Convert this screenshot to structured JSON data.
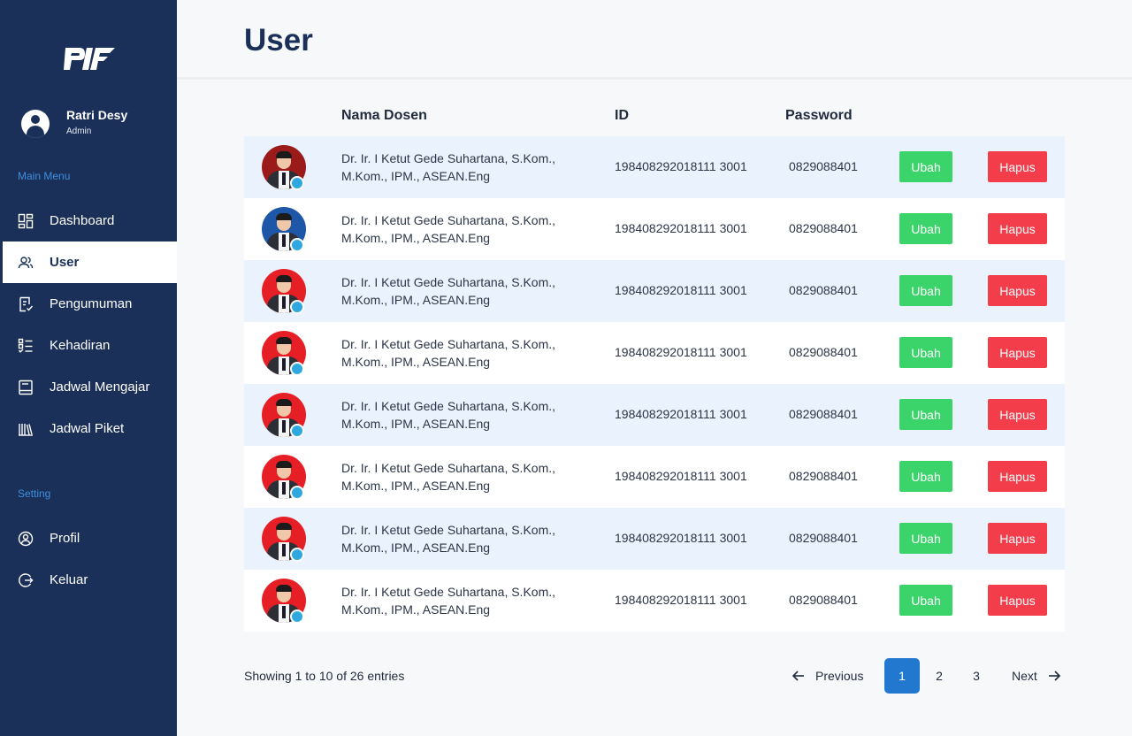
{
  "sidebar": {
    "profile": {
      "name": "Ratri Desy",
      "role": "Admin"
    },
    "main_menu_label": "Main Menu",
    "main_items": [
      {
        "label": "Dashboard",
        "icon": "dashboard-icon"
      },
      {
        "label": "User",
        "icon": "users-icon",
        "active": true
      },
      {
        "label": "Pengumuman",
        "icon": "announcement-icon"
      },
      {
        "label": "Kehadiran",
        "icon": "attendance-list-icon"
      },
      {
        "label": "Jadwal Mengajar",
        "icon": "book-icon"
      },
      {
        "label": "Jadwal Piket",
        "icon": "library-icon"
      }
    ],
    "setting_label": "Setting",
    "setting_items": [
      {
        "label": "Profil",
        "icon": "profile-icon"
      },
      {
        "label": "Keluar",
        "icon": "logout-icon"
      }
    ]
  },
  "header": {
    "title": "User"
  },
  "table": {
    "columns": {
      "name": "Nama Dosen",
      "id": "ID",
      "password": "Password"
    },
    "rows": [
      {
        "name": "Dr. Ir. I Ketut Gede Suhartana, S.Kom., M.Kom., IPM., ASEAN.Eng",
        "id": "198408292018111 3001",
        "password": "0829088401",
        "edit": "Ubah",
        "delete": "Hapus"
      },
      {
        "name": "Dr. Ir. I Ketut Gede Suhartana, S.Kom., M.Kom., IPM., ASEAN.Eng",
        "id": "198408292018111 3001",
        "password": "0829088401",
        "edit": "Ubah",
        "delete": "Hapus"
      },
      {
        "name": "Dr. Ir. I Ketut Gede Suhartana, S.Kom., M.Kom., IPM., ASEAN.Eng",
        "id": "198408292018111 3001",
        "password": "0829088401",
        "edit": "Ubah",
        "delete": "Hapus"
      },
      {
        "name": "Dr. Ir. I Ketut Gede Suhartana, S.Kom., M.Kom., IPM., ASEAN.Eng",
        "id": "198408292018111 3001",
        "password": "0829088401",
        "edit": "Ubah",
        "delete": "Hapus"
      },
      {
        "name": "Dr. Ir. I Ketut Gede Suhartana, S.Kom., M.Kom., IPM., ASEAN.Eng",
        "id": "198408292018111 3001",
        "password": "0829088401",
        "edit": "Ubah",
        "delete": "Hapus"
      },
      {
        "name": "Dr. Ir. I Ketut Gede Suhartana, S.Kom., M.Kom., IPM., ASEAN.Eng",
        "id": "198408292018111 3001",
        "password": "0829088401",
        "edit": "Ubah",
        "delete": "Hapus"
      },
      {
        "name": "Dr. Ir. I Ketut Gede Suhartana, S.Kom., M.Kom., IPM., ASEAN.Eng",
        "id": "198408292018111 3001",
        "password": "0829088401",
        "edit": "Ubah",
        "delete": "Hapus"
      },
      {
        "name": "Dr. Ir. I Ketut Gede Suhartana, S.Kom., M.Kom., IPM., ASEAN.Eng",
        "id": "198408292018111 3001",
        "password": "0829088401",
        "edit": "Ubah",
        "delete": "Hapus"
      }
    ]
  },
  "footer": {
    "info": "Showing 1 to 10 of 26 entries",
    "previous": "Previous",
    "next": "Next",
    "pages": [
      "1",
      "2",
      "3"
    ],
    "current_page": "1"
  },
  "colors": {
    "sidebar_bg": "#1a3058",
    "accent_blue": "#2277cf",
    "edit_green": "#3ad46a",
    "delete_red": "#f43d4a",
    "row_shade": "#eaf3fd",
    "online_dot": "#2fa8e0"
  }
}
